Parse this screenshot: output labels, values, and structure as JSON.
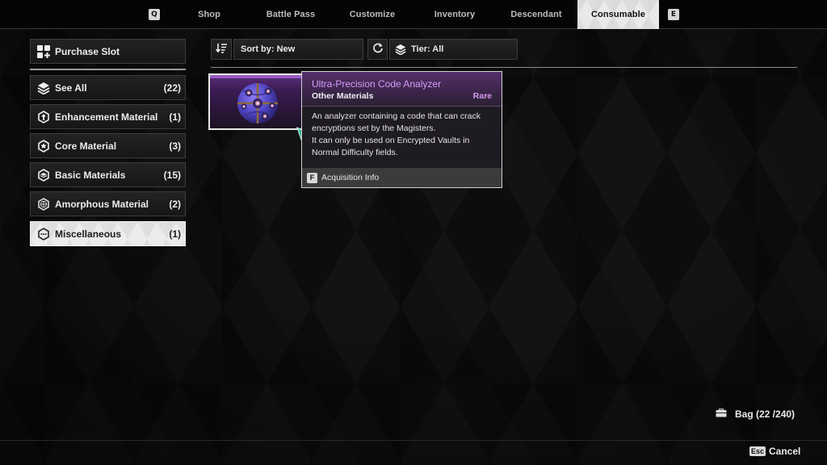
{
  "topnav": {
    "prev_key": "Q",
    "next_key": "E",
    "tabs": [
      {
        "label": "Shop",
        "active": false
      },
      {
        "label": "Battle Pass",
        "active": false
      },
      {
        "label": "Customize",
        "active": false
      },
      {
        "label": "Inventory",
        "active": false
      },
      {
        "label": "Descendant",
        "active": false
      },
      {
        "label": "Consumable",
        "active": true
      }
    ]
  },
  "sidebar": {
    "purchase_slot": {
      "label": "Purchase Slot",
      "icon": "grid-plus-icon"
    },
    "categories": [
      {
        "label": "See All",
        "count": "(22)",
        "icon": "layers-icon",
        "active": false
      },
      {
        "label": "Enhancement Material",
        "count": "(1)",
        "icon": "upgrade-arrow-icon",
        "active": false
      },
      {
        "label": "Core Material",
        "count": "(3)",
        "icon": "star-hexagon-icon",
        "active": false
      },
      {
        "label": "Basic Materials",
        "count": "(15)",
        "icon": "stack-hexagon-icon",
        "active": false
      },
      {
        "label": "Amorphous Material",
        "count": "(2)",
        "icon": "globe-hexagon-icon",
        "active": false
      },
      {
        "label": "Miscellaneous",
        "count": "(1)",
        "icon": "dots-hexagon-icon",
        "active": true
      }
    ]
  },
  "toolbar": {
    "sort_icon": "sort-descending-icon",
    "sort_label": "Sort by: New",
    "refresh_icon": "refresh-icon",
    "tier_icon": "layers-icon",
    "tier_label": "Tier: All"
  },
  "item": {
    "name": "Ultra-Precision Code Analyzer",
    "category": "Other Materials",
    "rarity": "Rare",
    "rarity_color": "#d59cf5",
    "description_lines": [
      "An analyzer containing a code that can crack",
      "encryptions set by the Magisters.",
      "It can only be used on Encrypted Vaults in",
      "Normal Difficulty fields."
    ],
    "acquisition_key": "F",
    "acquisition_label": "Acquisition Info"
  },
  "footer": {
    "bag_label": "Bag (22 /240)",
    "cancel_key": "Esc",
    "cancel_label": "Cancel"
  }
}
